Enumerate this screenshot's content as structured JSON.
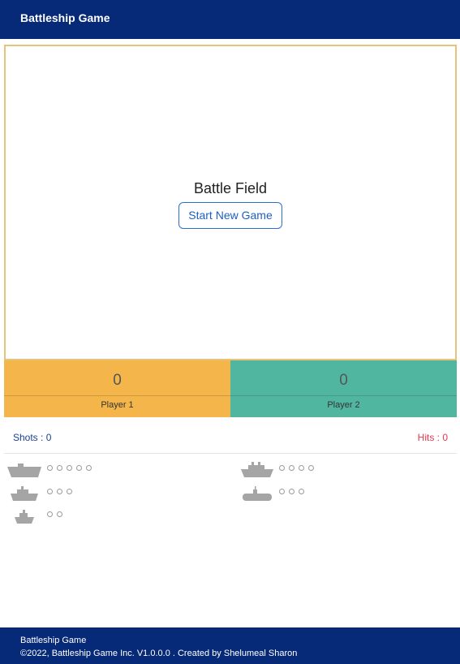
{
  "header": {
    "title": "Battleship Game"
  },
  "battlefield": {
    "title": "Battle Field",
    "start_button": "Start New Game"
  },
  "players": [
    {
      "score": "0",
      "name": "Player 1",
      "color": "#f4b54a"
    },
    {
      "score": "0",
      "name": "Player 2",
      "color": "#50b6a0"
    }
  ],
  "stats": {
    "shots": "Shots : 0",
    "hits": "Hits : 0"
  },
  "fleet": {
    "left": [
      {
        "icon": "carrier-icon",
        "holes": 5
      },
      {
        "icon": "cruiser-icon",
        "holes": 3
      },
      {
        "icon": "destroyer-icon",
        "holes": 2
      }
    ],
    "right": [
      {
        "icon": "battleship-icon",
        "holes": 4
      },
      {
        "icon": "submarine-icon",
        "holes": 3
      }
    ]
  },
  "footer": {
    "line1": "Battleship Game",
    "line2": "©2022, Battleship Game Inc. V1.0.0.0 . Created by Shelumeal Sharon"
  },
  "colors": {
    "nav": "#062a78",
    "field_border": "#e6c27a",
    "hits": "#e8364e",
    "shots": "#1a3f94"
  }
}
